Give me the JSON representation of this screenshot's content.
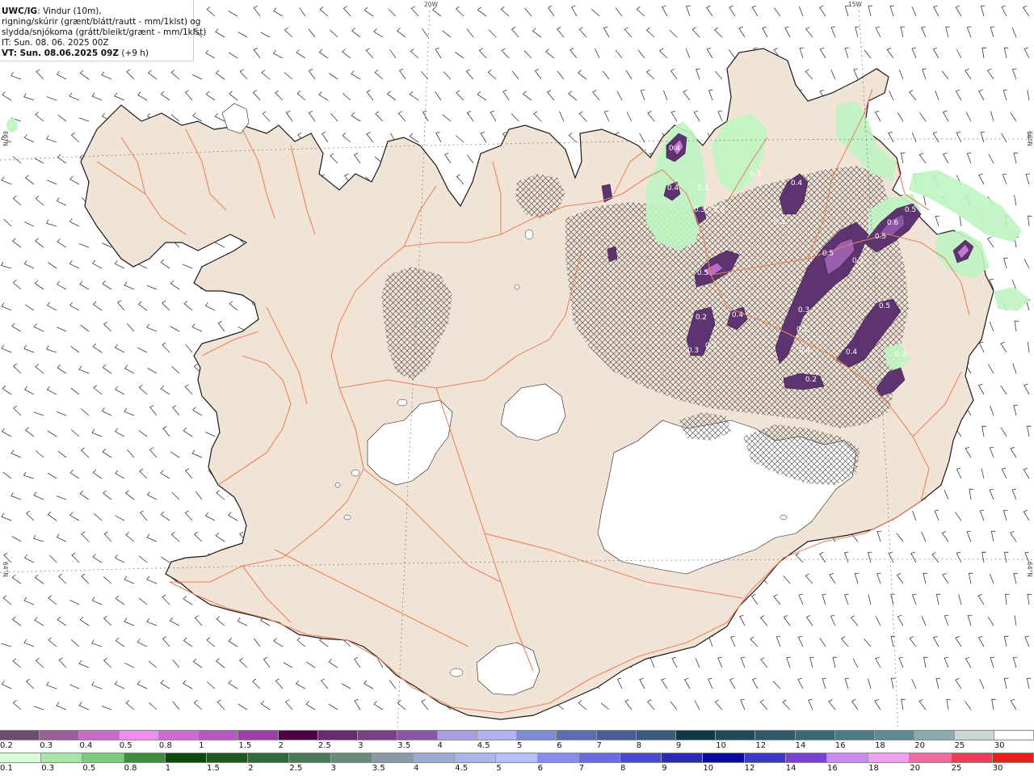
{
  "header": {
    "source": "UWC/IG",
    "line1_rest": ": Vindur (10m),",
    "line2": "rigning/skúrir (grænt/blátt/rautt - mm/1klst) og",
    "line3": "slydda/snjókoma (grátt/bleikt/grænt - mm/1klst)",
    "line4": "IT: Sun. 08. 06. 2025 00Z",
    "line5": "VT: Sun. 08.06.2025 09Z",
    "line5_rest": " (+9 h)"
  },
  "grid_labels": {
    "lon_west_20": "20W",
    "lon_west_15": "15W",
    "lat_66_left": "66°N",
    "lat_66_right": "66°N",
    "lat_64_left": "64°N",
    "lat_64_right": "64°N"
  },
  "colors": {
    "land": "#f1e4d7",
    "road": "#e9835c",
    "coast": "#1a1a1a",
    "glacier": "#ffffff",
    "rain_light_green": "#bff5c2",
    "snow_purple": "#6a3d7e",
    "wind_barb": "#3a3a3a",
    "hatch": "#333333"
  },
  "precip_labels": [
    {
      "text": "0.4"
    },
    {
      "text": "0.4"
    },
    {
      "text": "0.3"
    },
    {
      "text": "0.3"
    },
    {
      "text": "0.3"
    },
    {
      "text": "0.5"
    },
    {
      "text": "0.6"
    },
    {
      "text": "0.5"
    },
    {
      "text": "0.5"
    },
    {
      "text": "0.3"
    },
    {
      "text": "0.5"
    },
    {
      "text": "0.3"
    },
    {
      "text": "0.2"
    },
    {
      "text": "0.4"
    },
    {
      "text": "0.4"
    },
    {
      "text": "0.2"
    },
    {
      "text": "0.3"
    },
    {
      "text": "0.3"
    },
    {
      "text": "0.2"
    },
    {
      "text": "0.4"
    },
    {
      "text": "0.4"
    },
    {
      "text": "0.3"
    },
    {
      "text": "0.5"
    },
    {
      "text": "0.3"
    },
    {
      "text": "0.2"
    }
  ],
  "legend_snow": {
    "ticks": [
      "0.2",
      "0.3",
      "0.4",
      "0.5",
      "0.8",
      "1",
      "1.5",
      "2",
      "2.5",
      "3",
      "3.5",
      "4",
      "4.5",
      "5",
      "6",
      "7",
      "8",
      "9",
      "10",
      "12",
      "14",
      "16",
      "18",
      "20",
      "25",
      "30"
    ],
    "colors": [
      "#6e4b6e",
      "#9a5f9a",
      "#c46cc6",
      "#f08cf0",
      "#d26ad6",
      "#b65ac0",
      "#9c3fa8",
      "#4e0046",
      "#6a2a72",
      "#7b3f8a",
      "#8a55a6",
      "#a89ee0",
      "#b2b2f2",
      "#7a8cd8",
      "#5c6eb2",
      "#4a5e9a",
      "#3a5a7e",
      "#0e3a48",
      "#1e4a5a",
      "#2c5a6a",
      "#3a6a78",
      "#4a7a86",
      "#5e8a94",
      "#8aaaaf",
      "#c8d6d4",
      "#ffffff"
    ]
  },
  "legend_rain": {
    "ticks": [
      "0.1",
      "0.3",
      "0.5",
      "0.8",
      "1",
      "1.5",
      "2",
      "2.5",
      "3",
      "3.5",
      "4",
      "4.5",
      "5",
      "6",
      "7",
      "8",
      "9",
      "10",
      "12",
      "14",
      "16",
      "18",
      "20",
      "25",
      "30"
    ],
    "colors": [
      "#d8fbd8",
      "#a6e6a6",
      "#7ccc7c",
      "#3e8e3e",
      "#0a4a0a",
      "#1e5a1e",
      "#2e6a3a",
      "#4a7a5a",
      "#6a8a7a",
      "#8a9aa6",
      "#9aaad2",
      "#aab6ea",
      "#b6c0ff",
      "#8a8af0",
      "#6a6ae0",
      "#4a4acc",
      "#2a2ab6",
      "#0a0aa0",
      "#3a3ac6",
      "#7a42d0",
      "#c68af0",
      "#f0a0f0",
      "#f06aa0",
      "#f03a5a",
      "#f01a1a"
    ]
  }
}
